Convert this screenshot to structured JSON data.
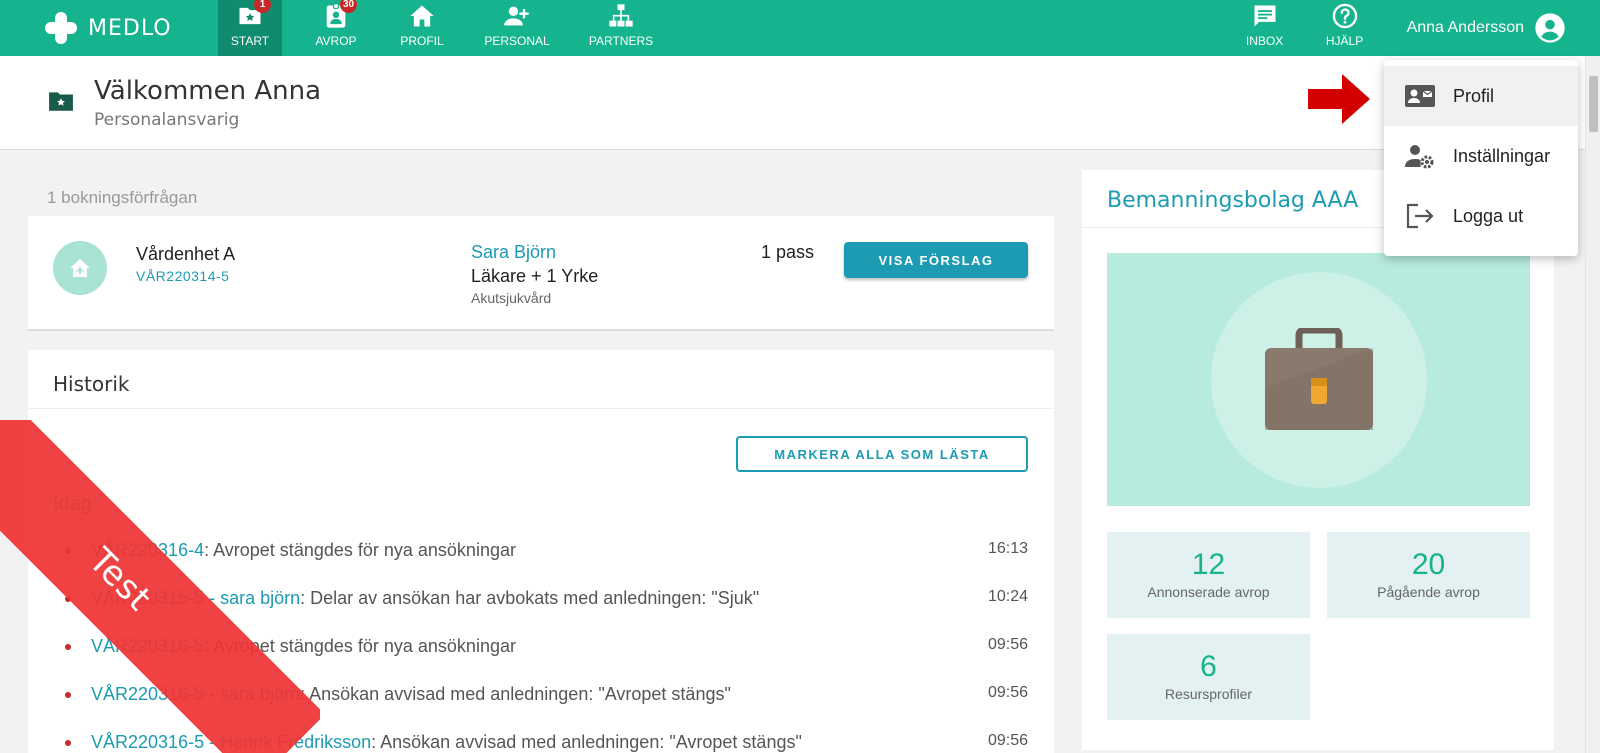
{
  "brand": {
    "name": "MEDLO"
  },
  "nav": {
    "items": [
      {
        "label": "START",
        "badge": "1"
      },
      {
        "label": "AVROP",
        "badge": "30"
      },
      {
        "label": "PROFIL"
      },
      {
        "label": "PERSONAL"
      },
      {
        "label": "PARTNERS"
      }
    ],
    "inbox": "INBOX",
    "help": "HJÄLP",
    "user_name": "Anna Andersson"
  },
  "welcome": {
    "title": "Välkommen Anna",
    "role": "Personalansvarig"
  },
  "requests": {
    "heading": "1 bokningsförfrågan",
    "unit_name": "Vårdenhet A",
    "unit_code": "VÅR220314-5",
    "person_name": "Sara Björn",
    "person_role": "Läkare + 1 Yrke",
    "person_dept": "Akutsjukvård",
    "pass_count": "1 pass",
    "button": "VISA FÖRSLAG"
  },
  "history": {
    "title": "Historik",
    "mark_all": "MARKERA ALLA SOM LÄSTA",
    "day": "Idag",
    "rows": [
      {
        "link": "VÅR220316-4",
        "text": ": Avropet stängdes för nya ansökningar",
        "time": "16:13"
      },
      {
        "link": "VÅR220315-5 - sara björn",
        "text": ": Delar av ansökan har avbokats med anledningen: \"Sjuk\"",
        "time": "10:24"
      },
      {
        "link": "VÅR220316-5",
        "text": ": Avropet stängdes för nya ansökningar",
        "time": "09:56"
      },
      {
        "link": "VÅR220316-5 - sara björn",
        "text": ": Ansökan avvisad med anledningen: \"Avropet stängs\"",
        "time": "09:56"
      },
      {
        "link": "VÅR220316-5 - Henrik Fredriksson",
        "text": ": Ansökan avvisad med anledningen: \"Avropet stängs\"",
        "time": "09:56"
      }
    ]
  },
  "agency": {
    "title": "Bemanningsbolag AAA",
    "stats": [
      {
        "value": "12",
        "label": "Annonserade avrop"
      },
      {
        "value": "20",
        "label": "Pågående avrop"
      },
      {
        "value": "6",
        "label": "Resursprofiler"
      }
    ]
  },
  "menu": {
    "items": [
      {
        "label": "Profil",
        "icon": "contact-card-icon"
      },
      {
        "label": "Inställningar",
        "icon": "user-settings-icon"
      },
      {
        "label": "Logga ut",
        "icon": "logout-icon"
      }
    ]
  },
  "ribbon": {
    "label": "Test"
  },
  "colors": {
    "primary": "#15b38e",
    "accent": "#1c9bb3",
    "badge": "#c62828",
    "arrow": "#d40000"
  }
}
